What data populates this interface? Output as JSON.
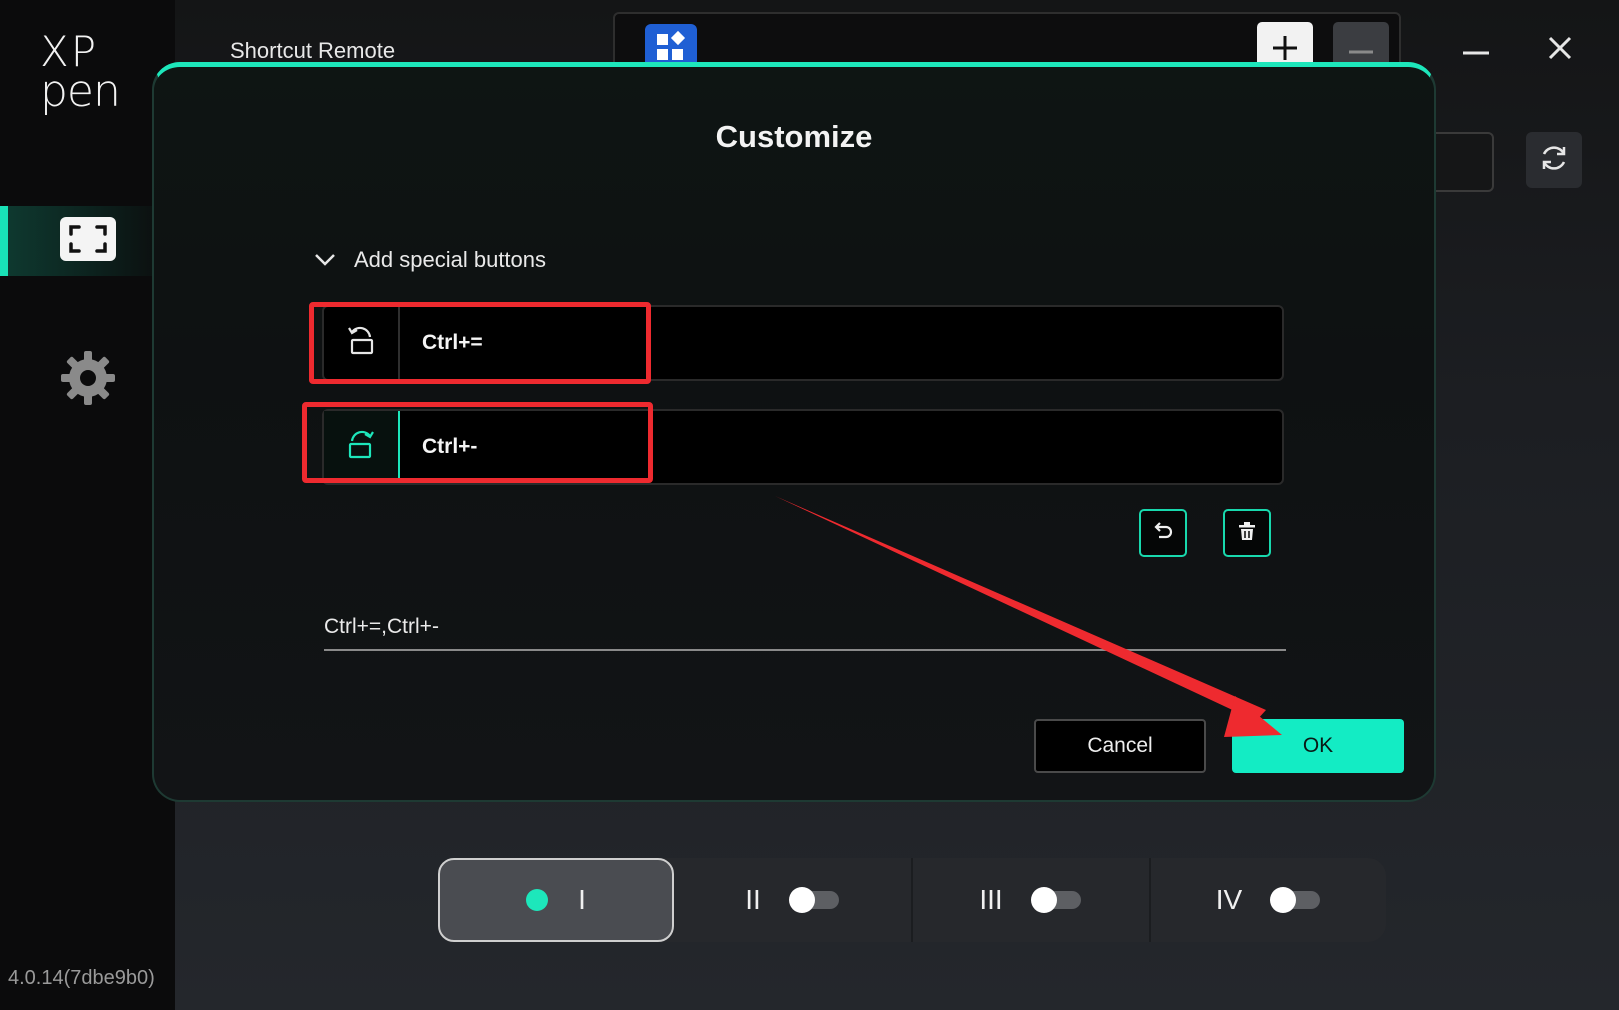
{
  "app": {
    "logo_line1": "XP",
    "logo_line2": "pen",
    "title": "Shortcut Remote",
    "version": "4.0.14(7dbe9b0)"
  },
  "colors": {
    "accent": "#1de7bb",
    "ok_button": "#13ecc4",
    "highlight": "#ee2a2f"
  },
  "sidebar": {
    "items": [
      {
        "icon": "fullscreen-frame-icon",
        "active": true
      },
      {
        "icon": "gear-icon",
        "active": false
      }
    ]
  },
  "toolbar": {
    "preset_icon": "apps-grid-icon",
    "add_icon": "plus-icon",
    "remove_icon": "minus-icon",
    "minimize_icon": "minimize-icon",
    "close_icon": "close-icon",
    "refresh_icon": "refresh-icon"
  },
  "dialog": {
    "title": "Customize",
    "section_label": "Add special buttons",
    "section_icon": "chevron-down-icon",
    "rows": [
      {
        "icon": "rotate-left-icon",
        "label": "Ctrl+="
      },
      {
        "icon": "rotate-right-icon",
        "label": "Ctrl+-"
      }
    ],
    "undo_icon": "undo-icon",
    "delete_icon": "trash-icon",
    "shortcut_value": "Ctrl+=,Ctrl+-",
    "cancel_label": "Cancel",
    "ok_label": "OK"
  },
  "tabs": [
    {
      "label": "I",
      "active": true,
      "enabled": true
    },
    {
      "label": "II",
      "active": false,
      "enabled": false
    },
    {
      "label": "III",
      "active": false,
      "enabled": false
    },
    {
      "label": "IV",
      "active": false,
      "enabled": false
    }
  ]
}
